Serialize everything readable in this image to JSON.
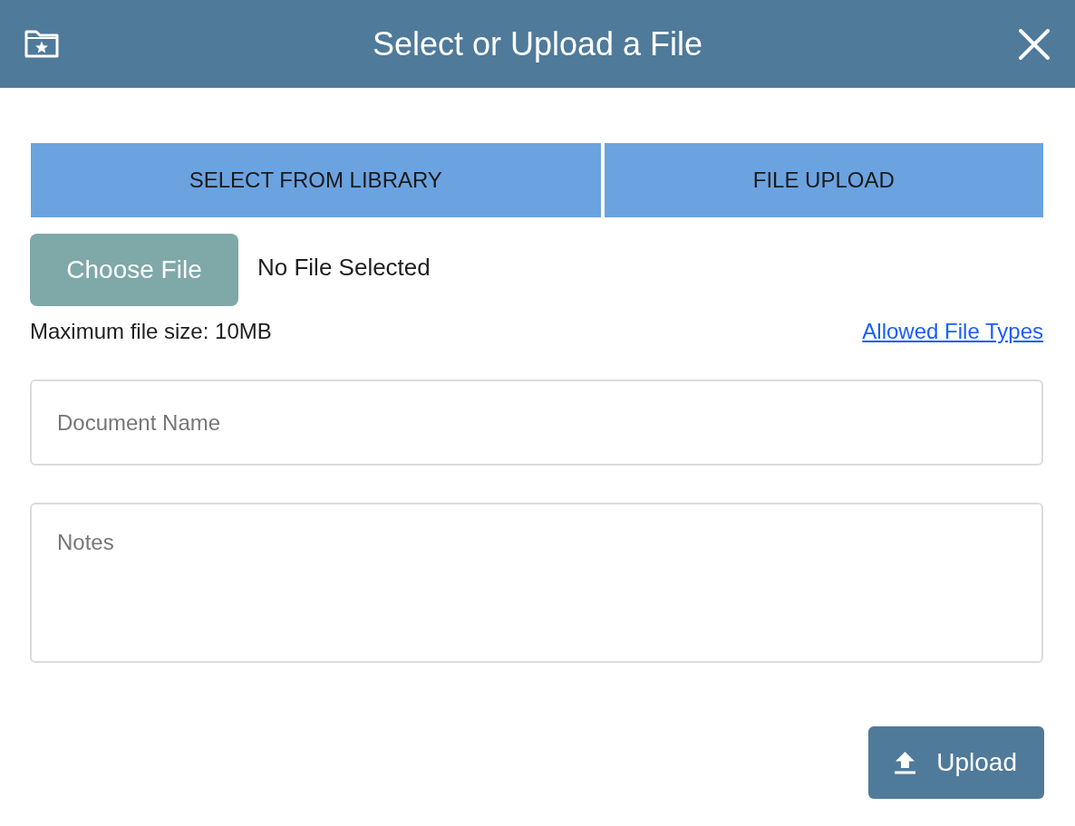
{
  "window": {
    "title": "Select or Upload a File"
  },
  "tabs": [
    {
      "label": "SELECT FROM LIBRARY"
    },
    {
      "label": "FILE UPLOAD"
    }
  ],
  "file_picker": {
    "button": "Choose File",
    "status": "No File Selected"
  },
  "limits": {
    "text": "Maximum file size: 10MB",
    "link": "Allowed File Types"
  },
  "fields": [
    {
      "kind": "input",
      "placeholder": "Document Name"
    },
    {
      "kind": "textarea",
      "placeholder": "Notes"
    }
  ],
  "actions": [
    {
      "label": "Upload"
    }
  ]
}
